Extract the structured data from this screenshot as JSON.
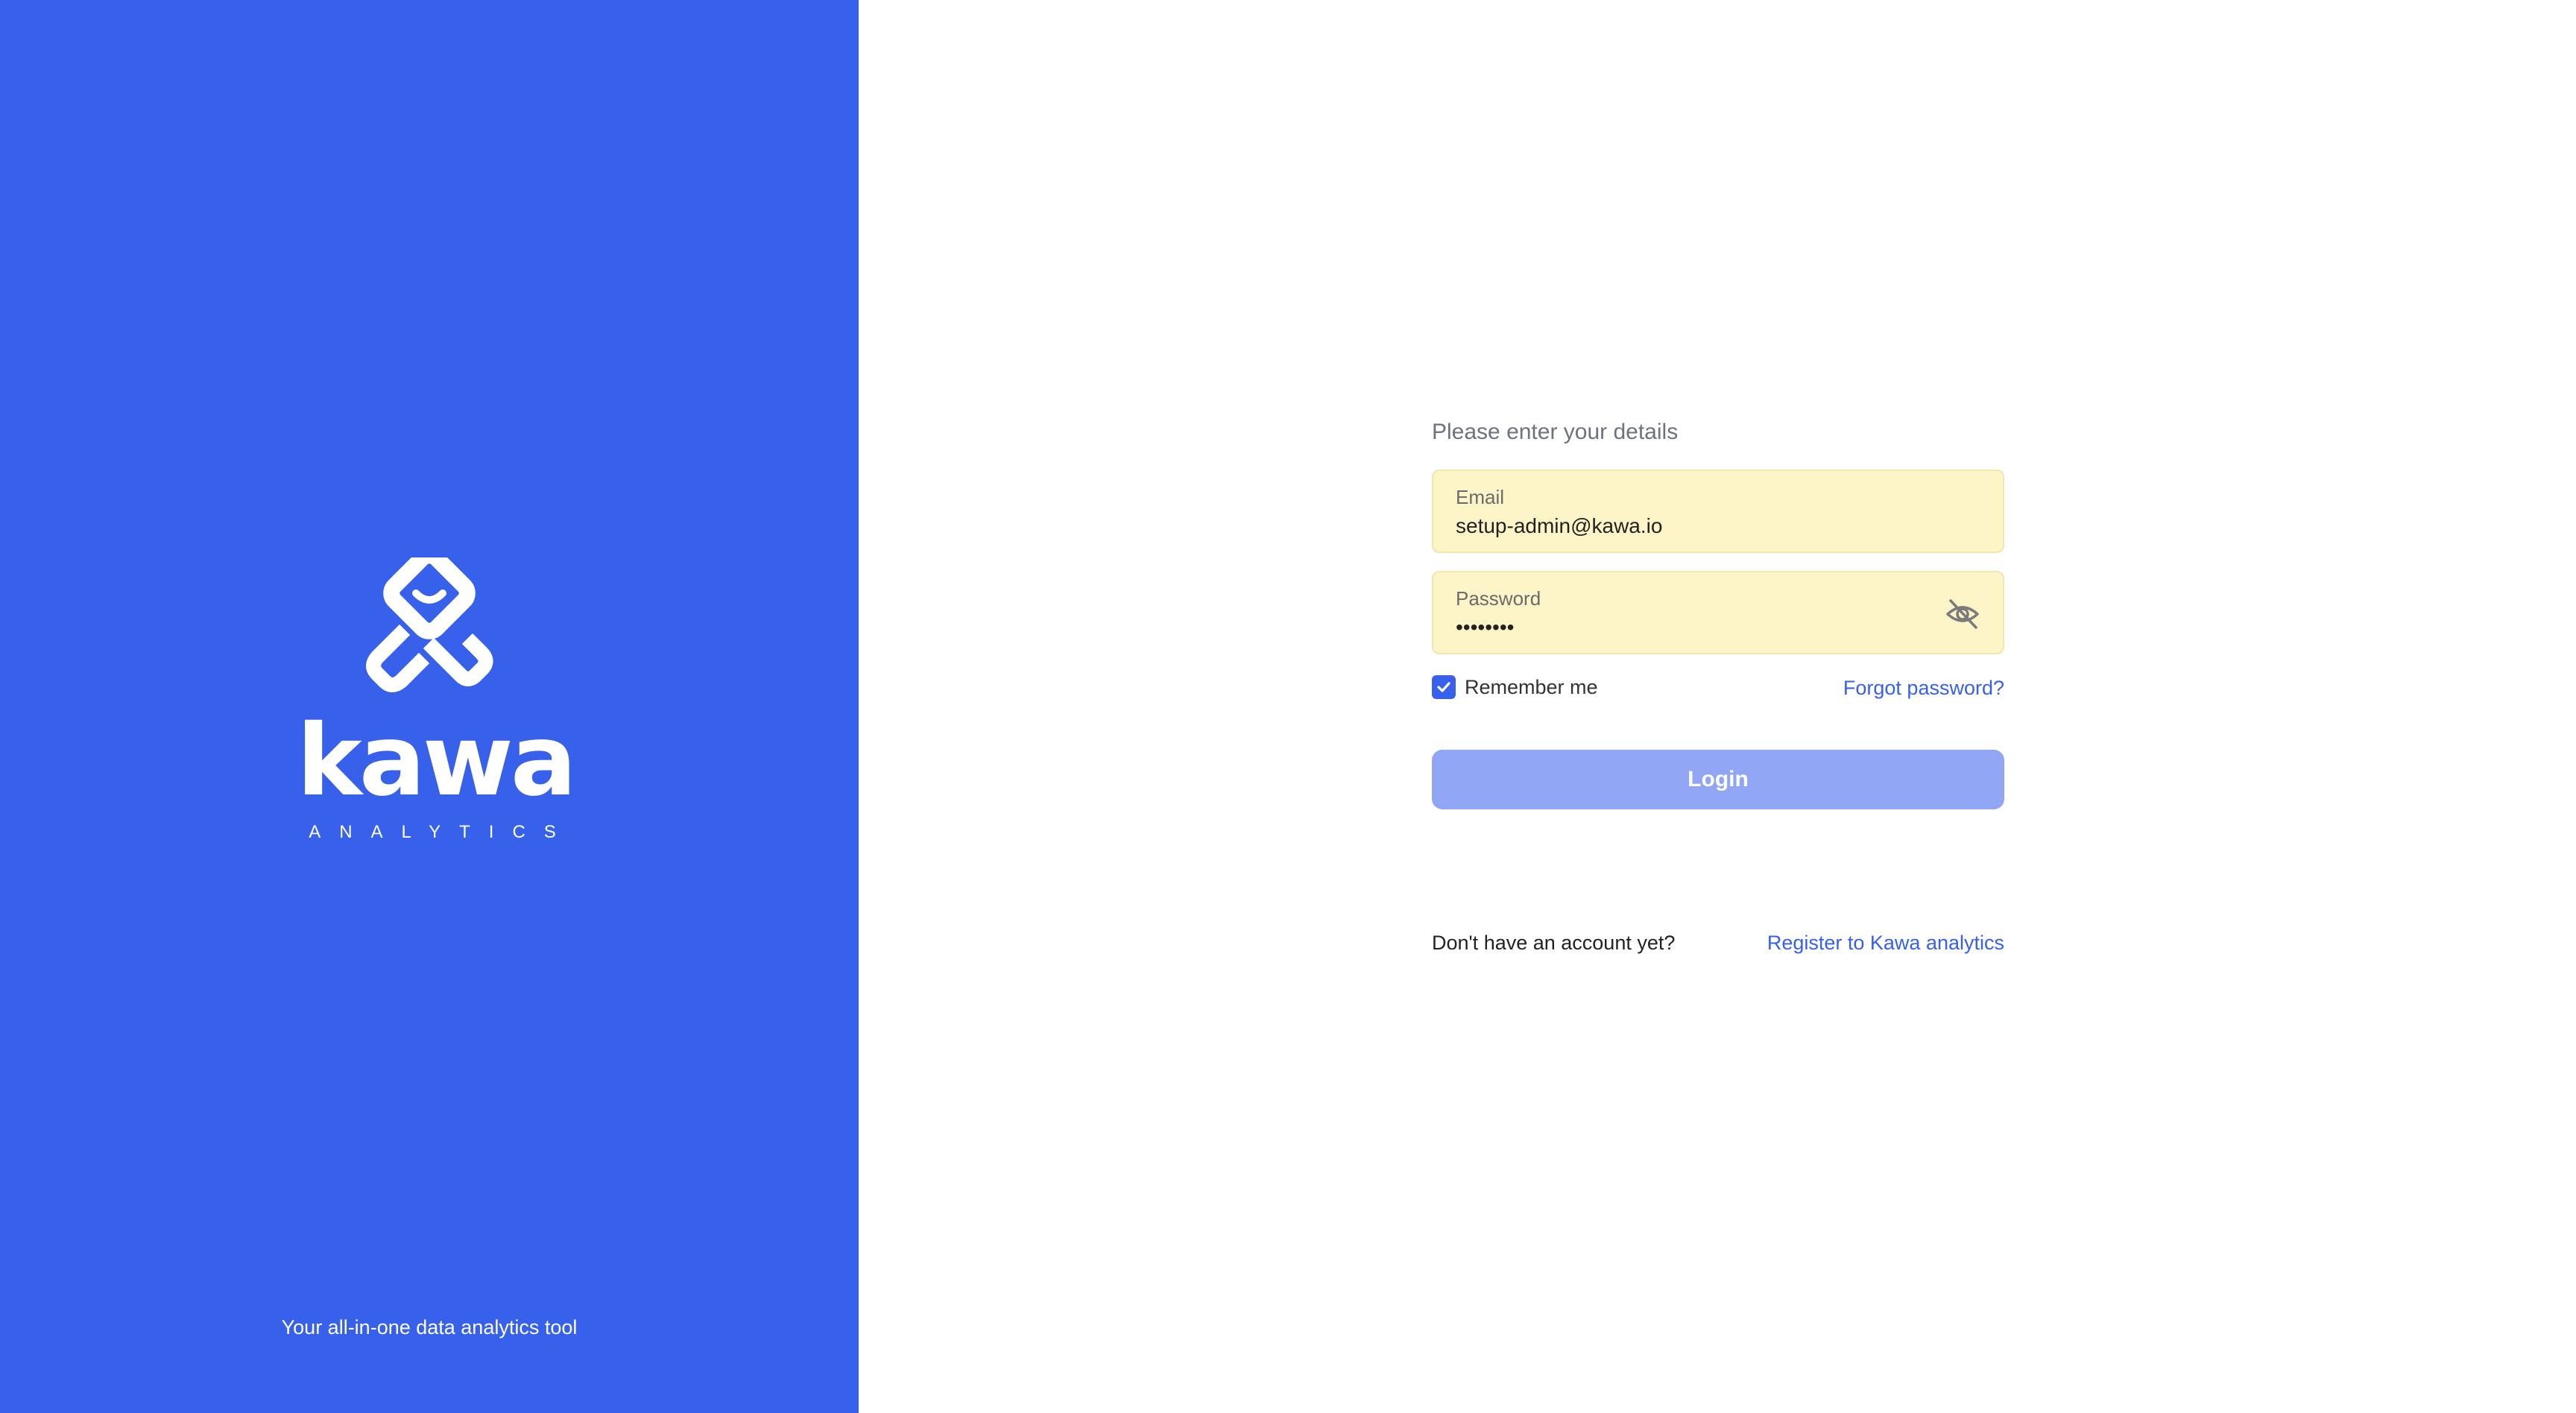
{
  "brand": {
    "name": "kawa",
    "sub": "ANALYTICS",
    "tagline": "Your all-in-one data analytics tool",
    "logo_icon": "kawa-logo-icon",
    "color": "#3760eb"
  },
  "form": {
    "subtitle": "Please enter your details",
    "email": {
      "label": "Email",
      "value": "setup-admin@kawa.io"
    },
    "password": {
      "label": "Password",
      "value": "••••••••",
      "toggle_icon": "eye-off-icon"
    },
    "remember_me": {
      "label": "Remember me",
      "checked": true
    },
    "forgot_password": "Forgot password?",
    "login_button": "Login",
    "no_account_text": "Don't have an account yet?",
    "register_link": "Register to Kawa analytics"
  },
  "colors": {
    "accent": "#3760eb",
    "field_bg": "#fdf4c7",
    "button_disabled": "#90a5f4"
  }
}
